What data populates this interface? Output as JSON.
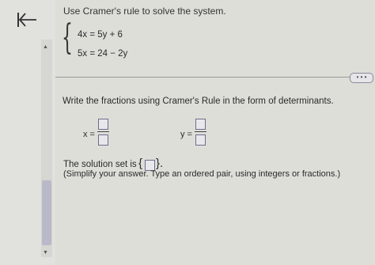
{
  "navigation": {
    "back_icon": "back-to-start-icon"
  },
  "problem": {
    "prompt": "Use Cramer's rule to solve the system.",
    "equation_1": "4x = 5y + 6",
    "equation_2": "5x = 24 − 2y"
  },
  "toolbar": {
    "more_label": "• • •"
  },
  "instructions": "Write the fractions using Cramer's Rule in the form of determinants.",
  "answer": {
    "x_label": "x =",
    "y_label": "y =",
    "solution_prefix": "The solution set is",
    "solution_open_brace": "{",
    "solution_close_brace": "}.",
    "hint": "(Simplify your answer. Type an ordered pair, using integers or fractions.)"
  }
}
